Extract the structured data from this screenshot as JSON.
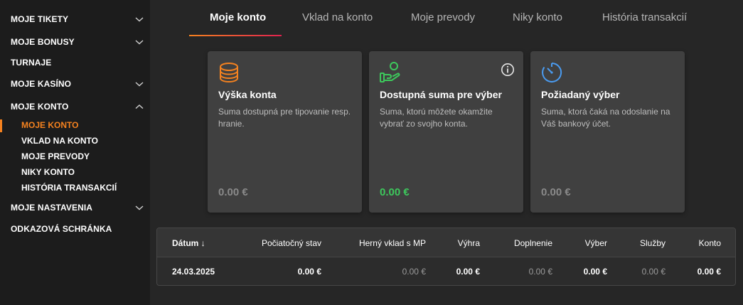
{
  "sidebar": {
    "items": [
      {
        "label": "MOJE TIKETY"
      },
      {
        "label": "MOJE BONUSY"
      },
      {
        "label": "TURNAJE"
      },
      {
        "label": "MOJE KASÍNO"
      },
      {
        "label": "MOJE KONTO"
      },
      {
        "label": "MOJE NASTAVENIA"
      },
      {
        "label": "ODKAZOVÁ SCHRÁNKA"
      }
    ],
    "subitems": [
      {
        "label": "MOJE KONTO"
      },
      {
        "label": "VKLAD NA KONTO"
      },
      {
        "label": "MOJE PREVODY"
      },
      {
        "label": "NIKY KONTO"
      },
      {
        "label": "HISTÓRIA TRANSAKCIÍ"
      }
    ]
  },
  "tabs": [
    {
      "label": "Moje konto"
    },
    {
      "label": "Vklad na konto"
    },
    {
      "label": "Moje prevody"
    },
    {
      "label": "Niky konto"
    },
    {
      "label": "História transakcií"
    }
  ],
  "cards": [
    {
      "title": "Výška konta",
      "desc": "Suma dostupná pre tipovanie resp. hranie.",
      "value": "0.00 €",
      "icon": "coins-stack-icon"
    },
    {
      "title": "Dostupná suma pre výber",
      "desc": "Suma, ktorú môžete okamžite vybrať zo svojho konta.",
      "value": "0.00 €",
      "icon": "hand-coin-icon",
      "info_icon": "info-icon"
    },
    {
      "title": "Požiadaný výber",
      "desc": "Suma, ktorá čaká na odoslanie na Váš bankový účet.",
      "value": "0.00 €",
      "icon": "stopwatch-icon"
    }
  ],
  "table": {
    "headers": {
      "datum": "Dátum ↓",
      "pociatocny": "Počiatočný stav",
      "herny": "Herný vklad s MP",
      "vyhra": "Výhra",
      "doplnenie": "Doplnenie",
      "vyber": "Výber",
      "sluzby": "Služby",
      "konto": "Konto"
    },
    "row": {
      "datum": "24.03.2025",
      "pociatocny": "0.00 €",
      "herny": "0.00 €",
      "vyhra": "0.00 €",
      "doplnenie": "0.00 €",
      "vyber": "0.00 €",
      "sluzby": "0.00 €",
      "konto": "0.00 €"
    }
  },
  "colors": {
    "accent": "#f5821f",
    "accent_gradient_end": "#e0224f",
    "green": "#3dc95c",
    "blue_icon": "#4a9bf0"
  }
}
